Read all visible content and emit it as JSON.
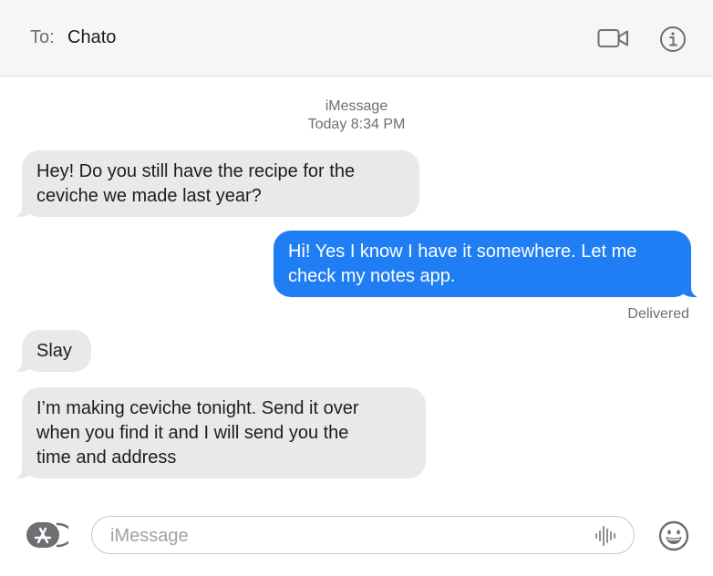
{
  "header": {
    "to_label": "To:",
    "recipient": "Chato",
    "video_icon": "video-camera-icon",
    "info_icon": "info-icon"
  },
  "conversation": {
    "service": "iMessage",
    "timestamp": "Today 8:34 PM",
    "messages": [
      {
        "direction": "incoming",
        "lines": [
          "Hey! Do you still have the recipe for the",
          "ceviche we made last year?"
        ]
      },
      {
        "direction": "outgoing",
        "lines": [
          "Hi! Yes I know I have it somewhere. Let me",
          "check my notes app."
        ]
      },
      {
        "direction": "incoming",
        "lines": [
          "Slay"
        ]
      },
      {
        "direction": "incoming",
        "lines": [
          "I’m making ceviche tonight. Send it over",
          "when you find it and I will send you the",
          "time and address"
        ]
      }
    ],
    "delivery_status": "Delivered"
  },
  "composer": {
    "apps_icon": "app-store-icon",
    "placeholder": "iMessage",
    "audio_icon": "audio-waveform-icon",
    "emoji_icon": "emoji-icon"
  },
  "colors": {
    "outgoing_bubble": "#1f7ef3",
    "incoming_bubble": "#e9e9eb",
    "header_bg": "#f6f6f6"
  }
}
